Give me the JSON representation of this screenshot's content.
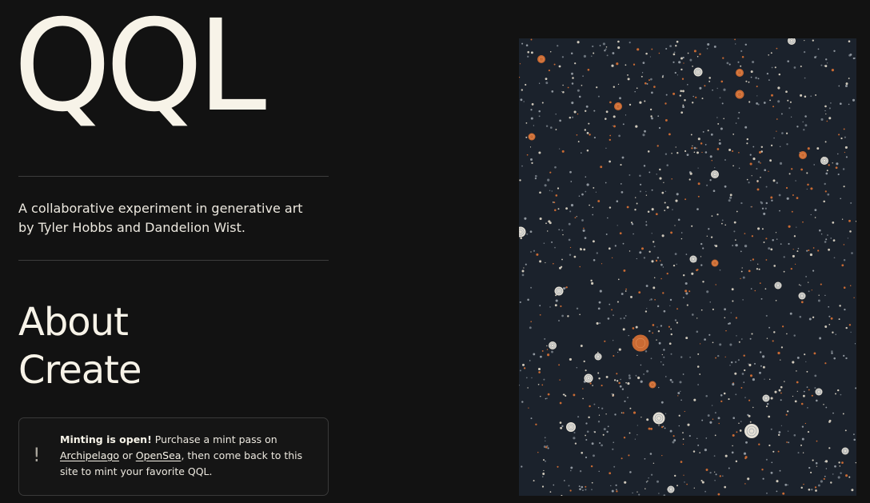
{
  "logo": {
    "text": "QQL"
  },
  "tagline": {
    "line1": "A collaborative experiment in generative art",
    "line2": "by Tyler Hobbs and Dandelion Wist."
  },
  "nav": {
    "about": "About",
    "create": "Create"
  },
  "notice": {
    "icon": "exclamation-icon",
    "bold": "Minting is open!",
    "text1": " Purchase a mint pass on ",
    "link1": "Archipelago",
    "text2": " or ",
    "link2": "OpenSea",
    "text3": ", then come back to this site to mint your favorite QQL."
  },
  "artwork": {
    "background": "#1b222c",
    "palette": [
      "#c96a33",
      "#e6e1d6",
      "#cfc8ba",
      "#8f969e",
      "#6b737c"
    ]
  },
  "colors": {
    "page_background": "#121212",
    "text": "#f7f3e8",
    "divider": "#3c3c3c"
  }
}
